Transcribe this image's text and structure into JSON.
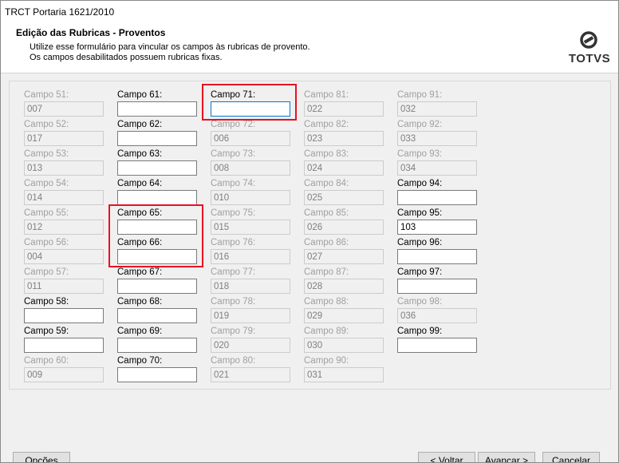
{
  "window": {
    "title": "TRCT Portaria 1621/2010"
  },
  "header": {
    "title": "Edição das Rubricas - Proventos",
    "description_line1": "Utilize esse formulário para vincular os campos às rubricas de provento.",
    "description_line2": "Os campos desabilitados possuem rubricas fixas."
  },
  "logo": {
    "text": "TOTVS",
    "icon": "totvs-logo-icon"
  },
  "fields": {
    "c51": {
      "label": "Campo 51:",
      "value": "007"
    },
    "c52": {
      "label": "Campo 52:",
      "value": "017"
    },
    "c53": {
      "label": "Campo 53:",
      "value": "013"
    },
    "c54": {
      "label": "Campo 54:",
      "value": "014"
    },
    "c55": {
      "label": "Campo 55:",
      "value": "012"
    },
    "c56": {
      "label": "Campo 56:",
      "value": "004"
    },
    "c57": {
      "label": "Campo 57:",
      "value": "011"
    },
    "c58": {
      "label": "Campo 58:",
      "value": ""
    },
    "c59": {
      "label": "Campo 59:",
      "value": ""
    },
    "c60": {
      "label": "Campo 60:",
      "value": "009"
    },
    "c61": {
      "label": "Campo 61:",
      "value": ""
    },
    "c62": {
      "label": "Campo 62:",
      "value": ""
    },
    "c63": {
      "label": "Campo 63:",
      "value": ""
    },
    "c64": {
      "label": "Campo 64:",
      "value": ""
    },
    "c65": {
      "label": "Campo 65:",
      "value": ""
    },
    "c66": {
      "label": "Campo 66:",
      "value": ""
    },
    "c67": {
      "label": "Campo 67:",
      "value": ""
    },
    "c68": {
      "label": "Campo 68:",
      "value": ""
    },
    "c69": {
      "label": "Campo 69:",
      "value": ""
    },
    "c70": {
      "label": "Campo 70:",
      "value": ""
    },
    "c71": {
      "label": "Campo 71:",
      "value": ""
    },
    "c72": {
      "label": "Campo 72:",
      "value": "006"
    },
    "c73": {
      "label": "Campo 73:",
      "value": "008"
    },
    "c74": {
      "label": "Campo 74:",
      "value": "010"
    },
    "c75": {
      "label": "Campo 75:",
      "value": "015"
    },
    "c76": {
      "label": "Campo 76:",
      "value": "016"
    },
    "c77": {
      "label": "Campo 77:",
      "value": "018"
    },
    "c78": {
      "label": "Campo 78:",
      "value": "019"
    },
    "c79": {
      "label": "Campo 79:",
      "value": "020"
    },
    "c80": {
      "label": "Campo 80:",
      "value": "021"
    },
    "c81": {
      "label": "Campo 81:",
      "value": "022"
    },
    "c82": {
      "label": "Campo 82:",
      "value": "023"
    },
    "c83": {
      "label": "Campo 83:",
      "value": "024"
    },
    "c84": {
      "label": "Campo 84:",
      "value": "025"
    },
    "c85": {
      "label": "Campo 85:",
      "value": "026"
    },
    "c86": {
      "label": "Campo 86:",
      "value": "027"
    },
    "c87": {
      "label": "Campo 87:",
      "value": "028"
    },
    "c88": {
      "label": "Campo 88:",
      "value": "029"
    },
    "c89": {
      "label": "Campo 89:",
      "value": "030"
    },
    "c90": {
      "label": "Campo 90:",
      "value": "031"
    },
    "c91": {
      "label": "Campo 91:",
      "value": "032"
    },
    "c92": {
      "label": "Campo 92:",
      "value": "033"
    },
    "c93": {
      "label": "Campo 93:",
      "value": "034"
    },
    "c94": {
      "label": "Campo 94:",
      "value": ""
    },
    "c95": {
      "label": "Campo 95:",
      "value": "103"
    },
    "c96": {
      "label": "Campo 96:",
      "value": ""
    },
    "c97": {
      "label": "Campo 97:",
      "value": ""
    },
    "c98": {
      "label": "Campo 98:",
      "value": "036"
    },
    "c99": {
      "label": "Campo 99:",
      "value": ""
    }
  },
  "buttons": {
    "options": "Opções",
    "back": "< Voltar",
    "next": "Avançar >",
    "cancel": "Cancelar"
  },
  "colors": {
    "highlight": "#e81123",
    "focus_border": "#0078d7",
    "disabled_text": "#a0a0a0"
  }
}
